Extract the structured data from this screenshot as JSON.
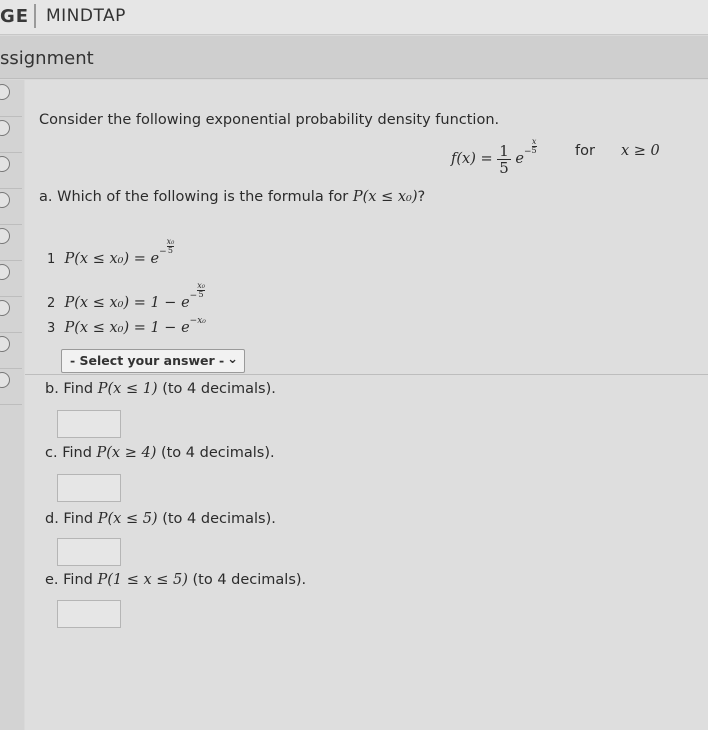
{
  "header": {
    "brand_left": "GE",
    "brand_right": "MINDTAP"
  },
  "assignment": {
    "title": "ssignment"
  },
  "question": {
    "intro": "Consider the following exponential probability density function.",
    "for_label": "for",
    "part_a": {
      "prefix": "a. Which of the following is the formula for",
      "suffix": "?"
    },
    "options": [
      "1",
      "2",
      "3"
    ],
    "select": {
      "placeholder": "- Select your answer -"
    },
    "part_b": {
      "prefix": "b. Find",
      "suffix": "(to 4 decimals)."
    },
    "part_c": {
      "prefix": "c. Find",
      "suffix": "(to 4 decimals)."
    },
    "part_d": {
      "prefix": "d. Find",
      "suffix": "(to 4 decimals)."
    },
    "part_e": {
      "prefix": "e. Find",
      "suffix": "(to 4 decimals)."
    }
  },
  "math": {
    "f_lhs": "f(x) = ",
    "one": "1",
    "five": "5",
    "e": "e",
    "neg": "−",
    "x": "x",
    "x0": "x₀",
    "cond": "x ≥ 0",
    "p_le_x0": "P(x ≤ x₀)",
    "opt1_lhs": "P(x ≤ x₀) = e",
    "opt2_lhs": "P(x ≤ x₀) = 1 − e",
    "opt3_lhs": "P(x ≤ x₀) = 1 − e",
    "opt3_exp": "−x₀",
    "p_b": "P(x ≤ 1)",
    "p_c": "P(x ≥ 4)",
    "p_d": "P(x ≤ 5)",
    "p_e": "P(1 ≤ x ≤ 5)"
  }
}
